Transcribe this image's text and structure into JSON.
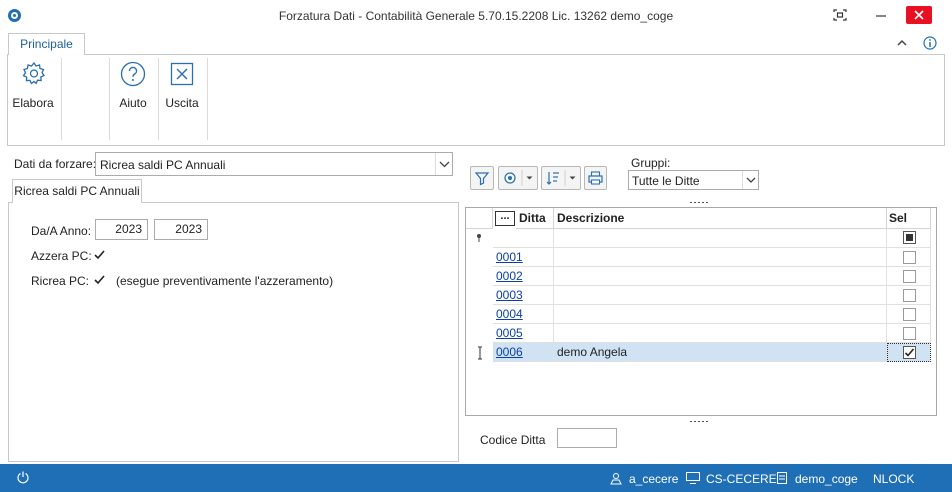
{
  "window": {
    "title": "Forzatura Dati - Contabilità Generale 5.70.15.2208 Lic. 13262 demo_coge",
    "icons": {
      "app": "app-logo-icon",
      "maximize": "fullscreen-icon",
      "minimize": "minimize-icon",
      "close": "close-icon"
    }
  },
  "ribbon": {
    "tab": "Principale",
    "buttons": [
      {
        "label": "Elabora",
        "icon": "gear-icon"
      },
      {
        "label": "Aiuto",
        "icon": "help-icon"
      },
      {
        "label": "Uscita",
        "icon": "exit-icon"
      }
    ]
  },
  "form": {
    "dati_label": "Dati da forzare:",
    "dati_value": "Ricrea saldi PC Annuali",
    "inner_tab": "Ricrea saldi PC Annuali",
    "da_anno_label": "Da/A Anno:",
    "anno_da": "2023",
    "anno_a": "2023",
    "azzera_label": "Azzera PC:",
    "azzera_checked": true,
    "ricrea_label": "Ricrea PC:",
    "ricrea_checked": true,
    "ricrea_note": "(esegue preventivamente l'azzeramento)"
  },
  "toolbar": {
    "gruppi_label": "Gruppi:",
    "gruppi_value": "Tutte le Ditte"
  },
  "grid": {
    "columns": {
      "chooser": "...",
      "ditta": "Ditta",
      "descrizione": "Descrizione",
      "sel": "Sel"
    },
    "rows": [
      {
        "ditta": "0001",
        "descrizione": "",
        "sel": false
      },
      {
        "ditta": "0002",
        "descrizione": "",
        "sel": false
      },
      {
        "ditta": "0003",
        "descrizione": "",
        "sel": false
      },
      {
        "ditta": "0004",
        "descrizione": "",
        "sel": false
      },
      {
        "ditta": "0005",
        "descrizione": "",
        "sel": false
      },
      {
        "ditta": "0006",
        "descrizione": "demo Angela",
        "sel": true
      }
    ]
  },
  "codice_ditta_label": "Codice Ditta",
  "codice_ditta_value": "",
  "statusbar": {
    "user": "a_cecere",
    "computer": "CS-CECERE",
    "database": "demo_coge",
    "nlock": "NLOCK"
  },
  "colors": {
    "accent": "#1f6fb7",
    "close": "#e81123",
    "selected_row": "#cfe3f4",
    "link": "#0b3fa8"
  }
}
